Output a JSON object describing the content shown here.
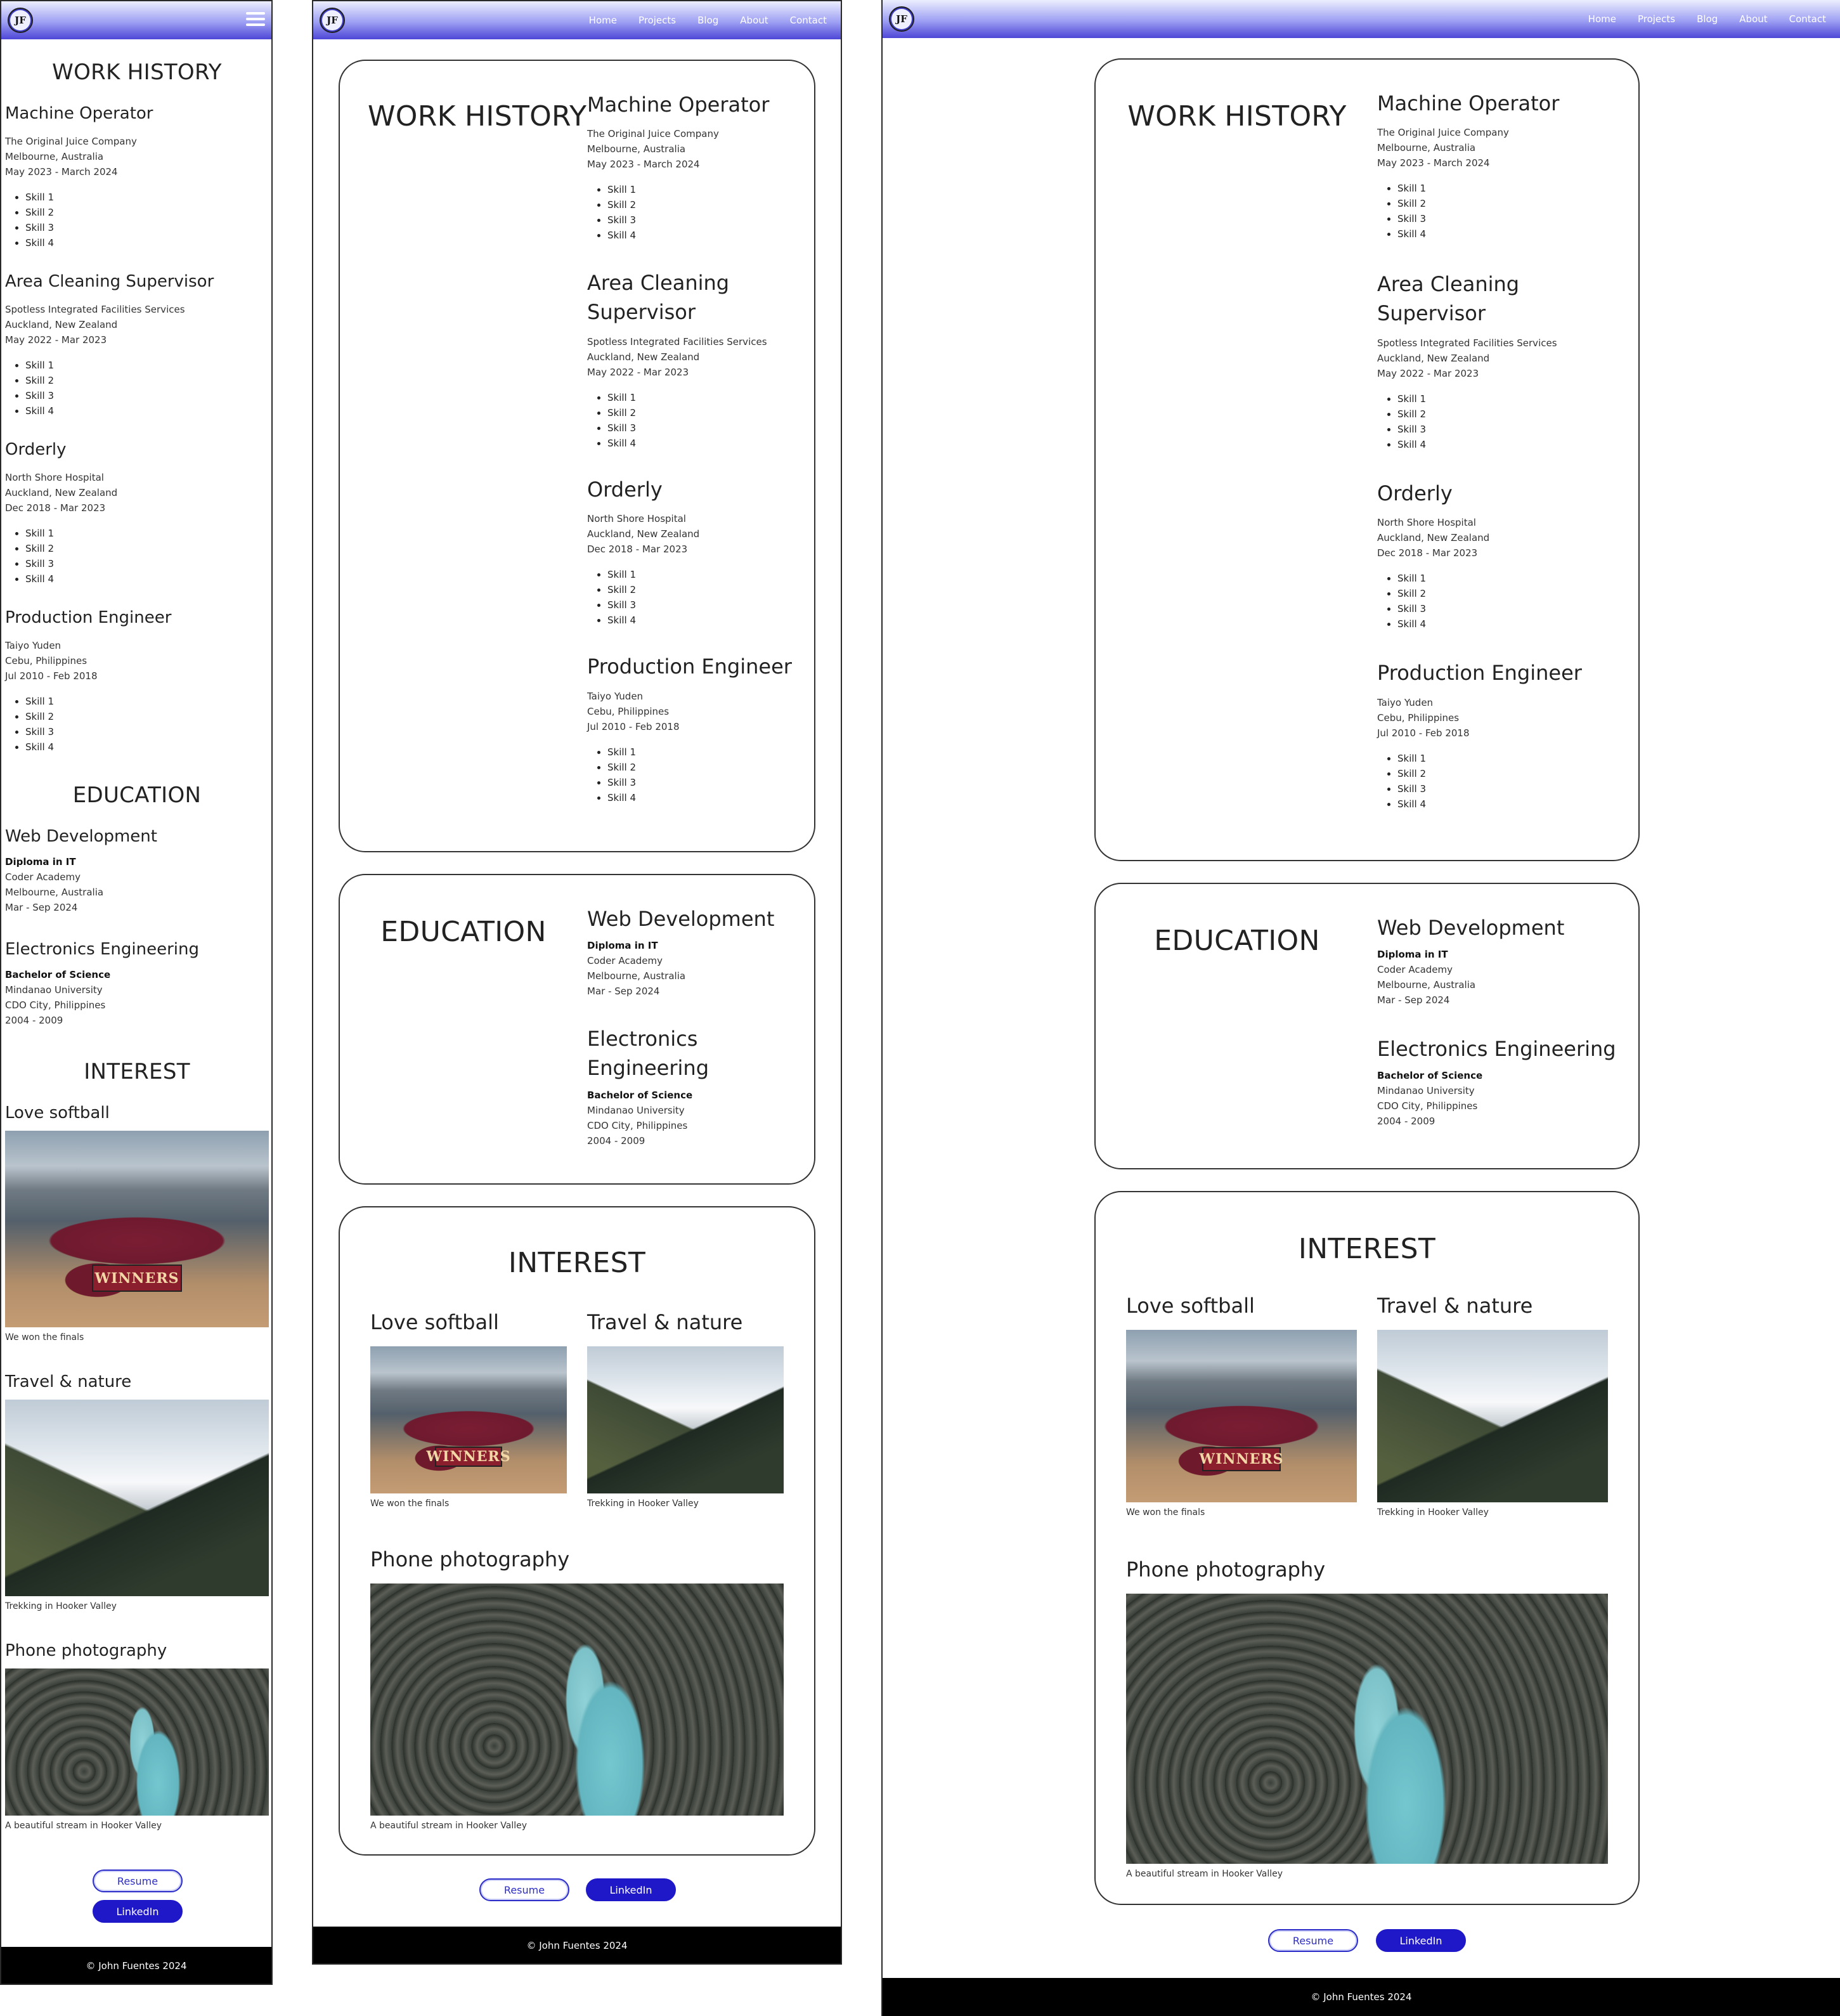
{
  "brand": {
    "logo_text": "JF"
  },
  "nav": {
    "links": [
      "Home",
      "Projects",
      "Blog",
      "About",
      "Contact"
    ]
  },
  "sections": {
    "work": "WORK HISTORY",
    "education": "EDUCATION",
    "interest": "INTEREST"
  },
  "jobs": [
    {
      "title": "Machine Operator",
      "company": "The Original Juice Company",
      "location": "Melbourne, Australia",
      "dates": "May 2023 - March 2024",
      "skills": [
        "Skill 1",
        "Skill 2",
        "Skill 3",
        "Skill 4"
      ]
    },
    {
      "title": "Area Cleaning Supervisor",
      "company": "Spotless Integrated Facilities Services",
      "location": "Auckland, New Zealand",
      "dates": "May 2022 - Mar 2023",
      "skills": [
        "Skill 1",
        "Skill 2",
        "Skill 3",
        "Skill 4"
      ]
    },
    {
      "title": "Orderly",
      "company": "North Shore Hospital",
      "location": "Auckland, New Zealand",
      "dates": "Dec 2018 - Mar 2023",
      "skills": [
        "Skill 1",
        "Skill 2",
        "Skill 3",
        "Skill 4"
      ]
    },
    {
      "title": "Production Engineer",
      "company": "Taiyo Yuden",
      "location": "Cebu, Philippines",
      "dates": "Jul 2010 - Feb 2018",
      "skills": [
        "Skill 1",
        "Skill 2",
        "Skill 3",
        "Skill 4"
      ]
    }
  ],
  "education": [
    {
      "title": "Web Development",
      "degree": "Diploma in IT",
      "school": "Coder Academy",
      "location": "Melbourne, Australia",
      "dates": "Mar - Sep 2024"
    },
    {
      "title": "Electronics Engineering",
      "degree": "Bachelor of Science",
      "school": "Mindanao University",
      "location": "CDO City, Philippines",
      "dates": "2004 - 2009"
    }
  ],
  "interests": [
    {
      "title": "Love softball",
      "caption": "We won the finals",
      "banner": "WINNERS"
    },
    {
      "title": "Travel & nature",
      "caption": "Trekking in Hooker Valley"
    },
    {
      "title": "Phone photography",
      "caption": "A beautiful stream in Hooker Valley"
    }
  ],
  "buttons": {
    "resume": "Resume",
    "linkedin": "LinkedIn"
  },
  "footer": {
    "text": "© John Fuentes 2024"
  }
}
